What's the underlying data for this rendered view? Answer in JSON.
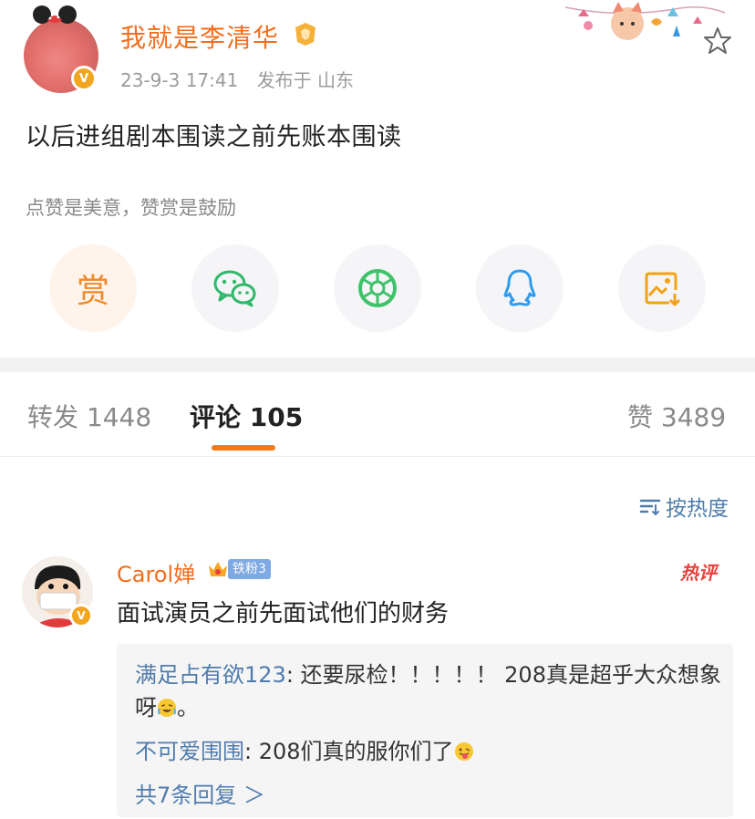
{
  "post": {
    "author": "我就是李清华",
    "time": "23-9-3 17:41",
    "location": "发布于 山东",
    "verified_mark": "V",
    "content": "以后进组剧本围读之前先账本围读"
  },
  "reward": {
    "tip": "点赞是美意，赞赏是鼓励",
    "reward_label": "赏"
  },
  "share_icons": [
    "reward-icon",
    "wechat-icon",
    "moments-icon",
    "qq-icon",
    "save-image-icon"
  ],
  "tabs": {
    "repost": "转发 1448",
    "comments": "评论 105",
    "likes": "赞 3489"
  },
  "sort": {
    "label": "按热度"
  },
  "comment": {
    "user": "Carol婵",
    "fan_level": "铁粉3",
    "hot_label": "热评",
    "verified_mark": "V",
    "text": "面试演员之前先面试他们的财务",
    "replies": [
      {
        "user": "满足占有欲123",
        "text": ": 还要尿检！！！！！ 208真是超乎大众想象呀",
        "suffix": "。"
      },
      {
        "user": "不可爱围围",
        "text": ": 208们真的服你们了",
        "suffix": ""
      }
    ],
    "more_replies": "共7条回复 ＞"
  },
  "colors": {
    "accent": "#f36d1c",
    "link": "#4f7cae",
    "tab_underline": "#f37b1c"
  }
}
